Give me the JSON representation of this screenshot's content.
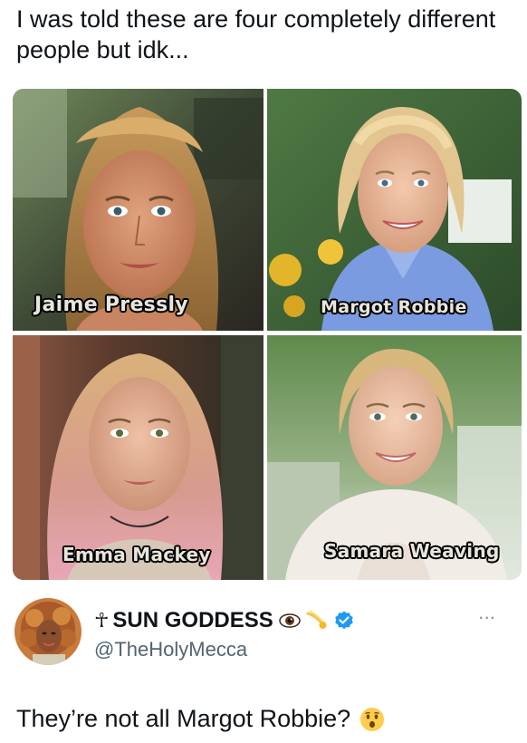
{
  "post": {
    "text": "I was told these are four completely different people but idk..."
  },
  "photos": [
    {
      "caption": "Jaime Pressly"
    },
    {
      "caption": "Margot Robbie"
    },
    {
      "caption": "Emma Mackey"
    },
    {
      "caption": "Samara Weaving"
    }
  ],
  "quoted": {
    "ankh": "☥",
    "display_name": "SUN GODDESS",
    "handle": "@TheHolyMecca",
    "more_label": "···"
  },
  "reply": {
    "text": "They’re not all Margot Robbie?"
  },
  "icons": {
    "eye": "eye-emoji-icon",
    "comet": "comet-emoji-icon",
    "verified": "verified-badge-icon",
    "surprised": "astonished-face-emoji-icon"
  },
  "colors": {
    "verified": "#1d9bf0",
    "handle": "#536471",
    "text": "#0f1419"
  }
}
